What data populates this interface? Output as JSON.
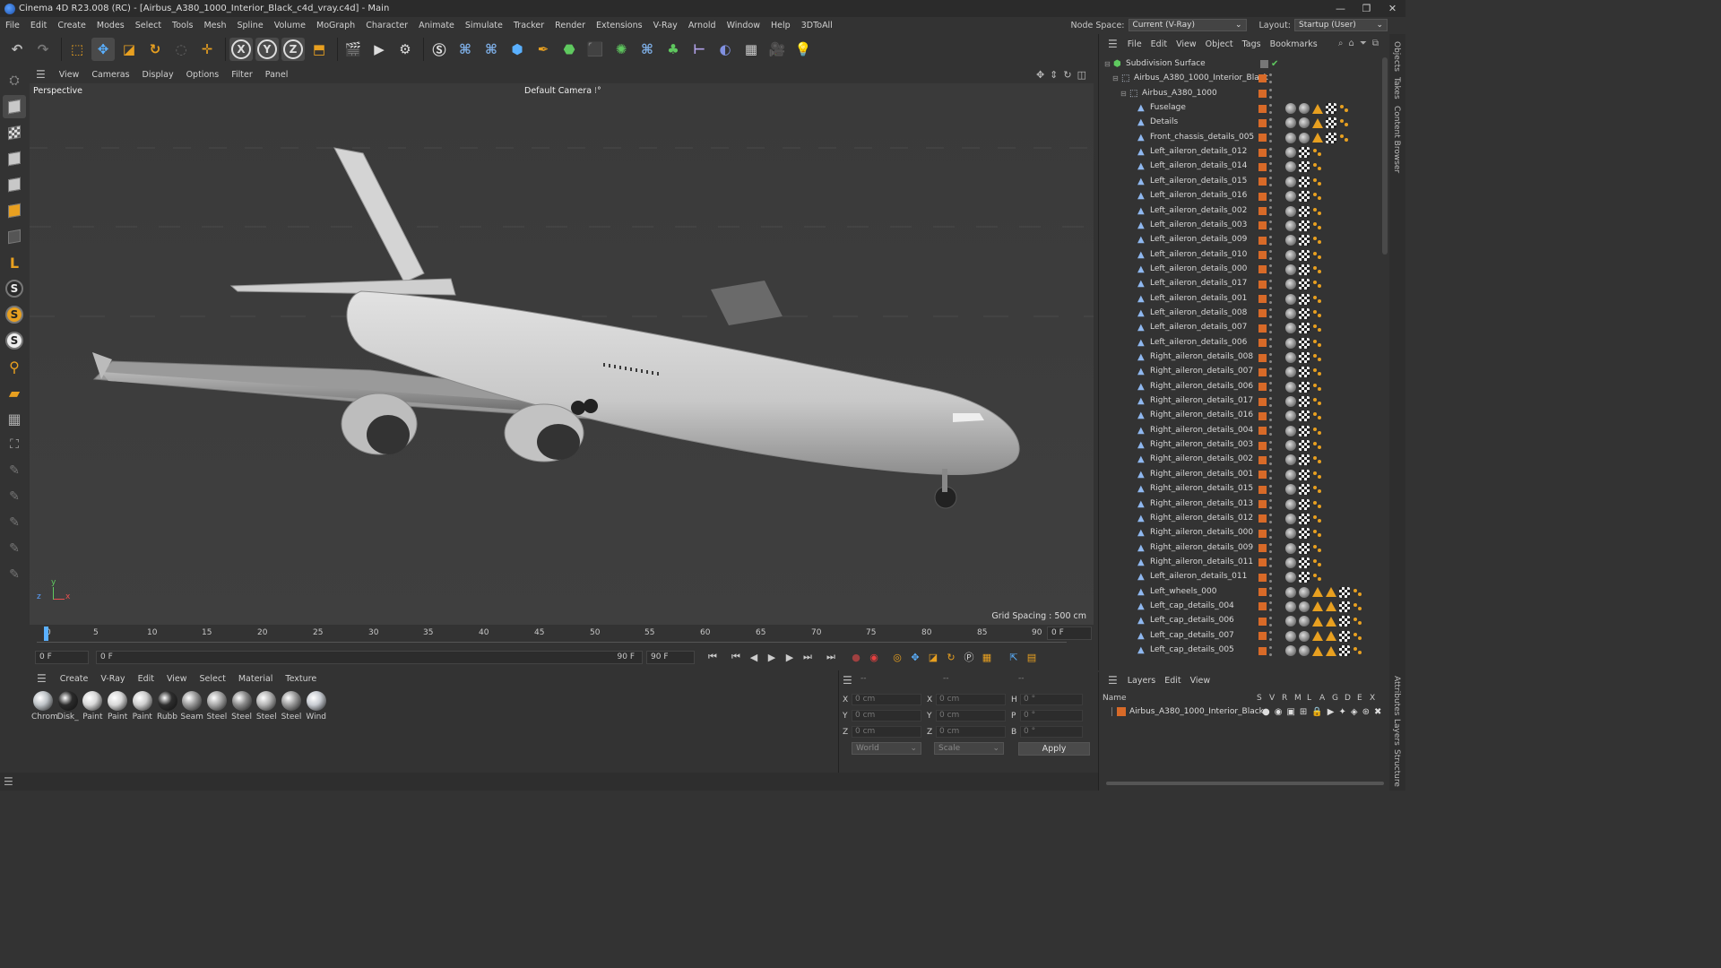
{
  "window": {
    "title": "Cinema 4D R23.008 (RC) - [Airbus_A380_1000_Interior_Black_c4d_vray.c4d] - Main",
    "controls": [
      "—",
      "❐",
      "✕"
    ]
  },
  "menubar": {
    "items": [
      "File",
      "Edit",
      "Create",
      "Modes",
      "Select",
      "Tools",
      "Mesh",
      "Spline",
      "Volume",
      "MoGraph",
      "Character",
      "Animate",
      "Simulate",
      "Tracker",
      "Render",
      "Extensions",
      "V-Ray",
      "Arnold",
      "Window",
      "Help",
      "3DToAll"
    ],
    "node_space_label": "Node Space:",
    "node_space_value": "Current (V-Ray)",
    "layout_label": "Layout:",
    "layout_value": "Startup (User)"
  },
  "toolbar": {
    "axis_x": "X",
    "axis_y": "Y",
    "axis_z": "Z"
  },
  "left_tools": {
    "s1": "S",
    "s2": "S",
    "s3": "S"
  },
  "viewport": {
    "menu": [
      "View",
      "Cameras",
      "Display",
      "Options",
      "Filter",
      "Panel"
    ],
    "label": "Perspective",
    "camera": "Default Camera ⁝°",
    "grid_spacing": "Grid Spacing : 500 cm",
    "axis_y": "y",
    "axis_z": "z",
    "axis_x": "x"
  },
  "timeline": {
    "ticks": [
      "0",
      "5",
      "10",
      "15",
      "20",
      "25",
      "30",
      "35",
      "40",
      "45",
      "50",
      "55",
      "60",
      "65",
      "70",
      "75",
      "80",
      "85",
      "90"
    ],
    "current_frame_field": "0 F",
    "start_field": "0 F",
    "range_start": "0 F",
    "range_end": "90 F",
    "end_field": "90 F"
  },
  "materials": {
    "menu": [
      "Create",
      "V-Ray",
      "Edit",
      "View",
      "Select",
      "Material",
      "Texture"
    ],
    "items": [
      {
        "label": "Chrom",
        "color": "#bfc4c8"
      },
      {
        "label": "Disk_",
        "color": "#2a2a2a"
      },
      {
        "label": "Paint",
        "color": "#d8d8d8"
      },
      {
        "label": "Paint",
        "color": "#d8d8d8"
      },
      {
        "label": "Paint",
        "color": "#cfcfcf"
      },
      {
        "label": "Rubb",
        "color": "#2d2d2d"
      },
      {
        "label": "Seam",
        "color": "#9a9a9a"
      },
      {
        "label": "Steel",
        "color": "#a8a8a8"
      },
      {
        "label": "Steel",
        "color": "#8c8c8c"
      },
      {
        "label": "Steel",
        "color": "#b4b4b4"
      },
      {
        "label": "Steel",
        "color": "#9c9c9c"
      },
      {
        "label": "Wind",
        "color": "#c8ccd2"
      }
    ]
  },
  "coordinates": {
    "header1": "--",
    "header2": "--",
    "header3": "--",
    "rows": [
      {
        "a": "X",
        "av": "0 cm",
        "b": "X",
        "bv": "0 cm",
        "c": "H",
        "cv": "0 °"
      },
      {
        "a": "Y",
        "av": "0 cm",
        "b": "Y",
        "bv": "0 cm",
        "c": "P",
        "cv": "0 °"
      },
      {
        "a": "Z",
        "av": "0 cm",
        "b": "Z",
        "bv": "0 cm",
        "c": "B",
        "cv": "0 °"
      }
    ],
    "space": "World",
    "mode": "Scale",
    "apply": "Apply"
  },
  "object_manager": {
    "menu": [
      "File",
      "Edit",
      "View",
      "Object",
      "Tags",
      "Bookmarks"
    ],
    "objects": [
      {
        "name": "Subdivision Surface",
        "level": 0,
        "kind": "subdiv"
      },
      {
        "name": "Airbus_A380_1000_Interior_Black",
        "level": 1,
        "kind": "null"
      },
      {
        "name": "Airbus_A380_1000",
        "level": 2,
        "kind": "null"
      },
      {
        "name": "Fuselage",
        "level": 3,
        "kind": "poly"
      },
      {
        "name": "Details",
        "level": 3,
        "kind": "poly"
      },
      {
        "name": "Front_chassis_details_005",
        "level": 3,
        "kind": "poly"
      },
      {
        "name": "Left_aileron_details_012",
        "level": 3,
        "kind": "poly"
      },
      {
        "name": "Left_aileron_details_014",
        "level": 3,
        "kind": "poly"
      },
      {
        "name": "Left_aileron_details_015",
        "level": 3,
        "kind": "poly"
      },
      {
        "name": "Left_aileron_details_016",
        "level": 3,
        "kind": "poly"
      },
      {
        "name": "Left_aileron_details_002",
        "level": 3,
        "kind": "poly"
      },
      {
        "name": "Left_aileron_details_003",
        "level": 3,
        "kind": "poly"
      },
      {
        "name": "Left_aileron_details_009",
        "level": 3,
        "kind": "poly"
      },
      {
        "name": "Left_aileron_details_010",
        "level": 3,
        "kind": "poly"
      },
      {
        "name": "Left_aileron_details_000",
        "level": 3,
        "kind": "poly"
      },
      {
        "name": "Left_aileron_details_017",
        "level": 3,
        "kind": "poly"
      },
      {
        "name": "Left_aileron_details_001",
        "level": 3,
        "kind": "poly"
      },
      {
        "name": "Left_aileron_details_008",
        "level": 3,
        "kind": "poly"
      },
      {
        "name": "Left_aileron_details_007",
        "level": 3,
        "kind": "poly"
      },
      {
        "name": "Left_aileron_details_006",
        "level": 3,
        "kind": "poly"
      },
      {
        "name": "Right_aileron_details_008",
        "level": 3,
        "kind": "poly"
      },
      {
        "name": "Right_aileron_details_007",
        "level": 3,
        "kind": "poly"
      },
      {
        "name": "Right_aileron_details_006",
        "level": 3,
        "kind": "poly"
      },
      {
        "name": "Right_aileron_details_017",
        "level": 3,
        "kind": "poly"
      },
      {
        "name": "Right_aileron_details_016",
        "level": 3,
        "kind": "poly"
      },
      {
        "name": "Right_aileron_details_004",
        "level": 3,
        "kind": "poly"
      },
      {
        "name": "Right_aileron_details_003",
        "level": 3,
        "kind": "poly"
      },
      {
        "name": "Right_aileron_details_002",
        "level": 3,
        "kind": "poly"
      },
      {
        "name": "Right_aileron_details_001",
        "level": 3,
        "kind": "poly"
      },
      {
        "name": "Right_aileron_details_015",
        "level": 3,
        "kind": "poly"
      },
      {
        "name": "Right_aileron_details_013",
        "level": 3,
        "kind": "poly"
      },
      {
        "name": "Right_aileron_details_012",
        "level": 3,
        "kind": "poly"
      },
      {
        "name": "Right_aileron_details_000",
        "level": 3,
        "kind": "poly"
      },
      {
        "name": "Right_aileron_details_009",
        "level": 3,
        "kind": "poly"
      },
      {
        "name": "Right_aileron_details_011",
        "level": 3,
        "kind": "poly"
      },
      {
        "name": "Left_aileron_details_011",
        "level": 3,
        "kind": "poly"
      },
      {
        "name": "Left_wheels_000",
        "level": 3,
        "kind": "poly"
      },
      {
        "name": "Left_cap_details_004",
        "level": 3,
        "kind": "poly"
      },
      {
        "name": "Left_cap_details_006",
        "level": 3,
        "kind": "poly"
      },
      {
        "name": "Left_cap_details_007",
        "level": 3,
        "kind": "poly"
      },
      {
        "name": "Left_cap_details_005",
        "level": 3,
        "kind": "poly"
      }
    ]
  },
  "layers": {
    "menu": [
      "Layers",
      "Edit",
      "View"
    ],
    "name_header": "Name",
    "flags": [
      "S",
      "V",
      "R",
      "M",
      "L",
      "A",
      "G",
      "D",
      "E",
      "X"
    ],
    "row_name": "Airbus_A380_1000_Interior_Black",
    "layer_color": "#d86a28"
  },
  "right_tabs": [
    "Objects",
    "Takes",
    "Content Browser",
    "Attributes",
    "Layers",
    "Structure"
  ],
  "colors": {
    "accent_orange": "#d86a28",
    "tag_yellow": "#e8a020",
    "check_green": "#5fc95f"
  }
}
